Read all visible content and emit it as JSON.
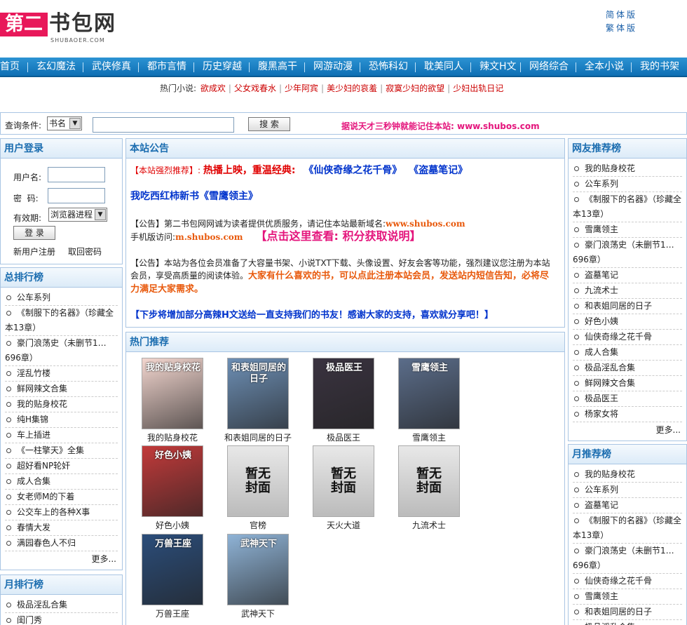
{
  "header": {
    "logo": {
      "red": "第二",
      "black": "书包网",
      "sub": "SHUBAOER.COM"
    },
    "lang": [
      "简体版",
      "繁体版"
    ]
  },
  "nav": [
    "首页",
    "玄幻魔法",
    "武侠修真",
    "都市言情",
    "历史穿越",
    "腹黑高干",
    "网游动漫",
    "恐怖科幻",
    "耽美同人",
    "辣文H文",
    "网络综合",
    "全本小说",
    "我的书架"
  ],
  "hot": {
    "label": "热门小说:",
    "items": [
      "欲成欢",
      "父女戏春水",
      "少年阿宾",
      "美少妇的哀羞",
      "寂寞少妇的欲望",
      "少妇出轨日记"
    ]
  },
  "search": {
    "label": "查询条件:",
    "select": "书名",
    "button": "搜 索",
    "tip": "据说天才三秒钟就能记住本站: www.shubos.com"
  },
  "login": {
    "title": "用户登录",
    "user": "用户名:",
    "pass": "密  码:",
    "expire": "有效期:",
    "expire_value": "浏览器进程",
    "submit": "登 录",
    "register": "新用户注册",
    "recover": "取回密码"
  },
  "rank_total": {
    "title": "总排行榜",
    "items": [
      "公车系列",
      "《制服下的名器》（珍藏全本13章）",
      "豪门浪荡史（未删节1…696章）",
      "淫乱竹楼",
      "鲜网辣文合集",
      "我的贴身校花",
      "纯H集锦",
      "车上插进",
      "《一柱擎天》全集",
      "超好看NP轮奸",
      "成人合集",
      "女老师M的下着",
      "公交车上的各种X事",
      "春情大发",
      "满园春色人不归"
    ],
    "more": "更多..."
  },
  "rank_month": {
    "title": "月排行榜",
    "items": [
      "极品淫乱合集",
      "闺门秀"
    ]
  },
  "notice": {
    "title": "本站公告",
    "rec_tag": "【本站强烈推荐】:",
    "rec_red": "热播上映，重温经典:",
    "rec_book1": "《仙侠奇缘之花千骨》",
    "rec_book2": "《盗墓笔记》",
    "rec_line2": "我吃西红柿新书《雪鹰领主》",
    "p1_a": "【公告】第二书包网网诚为读者提供优质服务，请记住本站最新域名:",
    "p1_domain": "www.shubos.com",
    "p1_b": "手机版访问:",
    "p1_mobile": "m.shubos.com",
    "p1_link": "【点击这里查看: 积分获取说明】",
    "p2_a": "【公告】本站为各位会员准备了大容量书架、小说TXT下载、头像设置、好友会客等功能，强烈建议您注册为本站会员，享受高质量的阅读体验。",
    "p2_b": "大家有什么喜欢的书，可以点此注册本站会员，发送站内短信告知，必将尽力满足大家需求。",
    "p3": "【下步将增加部分高辣H文送给一直支持我们的书友！感谢大家的支持，喜欢就分享吧！】"
  },
  "hotrec": {
    "title": "热门推荐",
    "books": [
      {
        "name": "我的贴身校花",
        "cover": "我的贴身校花"
      },
      {
        "name": "和表姐同居的日子",
        "cover": "和表姐同居的日子"
      },
      {
        "name": "极品医王",
        "cover": "极品医王"
      },
      {
        "name": "雪鹰领主",
        "cover": "雪鹰领主"
      },
      {
        "name": "好色小姨",
        "cover": "好色小姨"
      },
      {
        "name": "官榜",
        "cover": "暂无封面"
      },
      {
        "name": "天火大道",
        "cover": "暂无封面"
      },
      {
        "name": "九流术士",
        "cover": "暂无封面"
      },
      {
        "name": "万兽王座",
        "cover": "万兽王座"
      },
      {
        "name": "武神天下",
        "cover": "武神天下"
      }
    ]
  },
  "friend_rec": {
    "title": "网友推荐榜",
    "items": [
      "我的贴身校花",
      "公车系列",
      "《制服下的名器》（珍藏全本13章）",
      "雪鹰领主",
      "豪门浪荡史（未删节1…696章）",
      "盗墓笔记",
      "九流术士",
      "和表姐同居的日子",
      "好色小姨",
      "仙侠奇缘之花千骨",
      "成人合集",
      "极品淫乱合集",
      "鲜网辣文合集",
      "极品医王",
      "杨家女将"
    ],
    "more": "更多..."
  },
  "month_rec": {
    "title": "月推荐榜",
    "items": [
      "我的贴身校花",
      "公车系列",
      "盗墓笔记",
      "《制服下的名器》（珍藏全本13章）",
      "豪门浪荡史（未删节1…696章）",
      "仙侠奇缘之花千骨",
      "雪鹰领主",
      "和表姐同居的日子",
      "极品淫乱合集"
    ]
  },
  "colors": {
    "nav": "#1f84c6",
    "accent": "#1b6db0",
    "red": "#e00000",
    "pink": "#e4157c",
    "orange": "#e8590c",
    "blue": "#0033cc"
  }
}
